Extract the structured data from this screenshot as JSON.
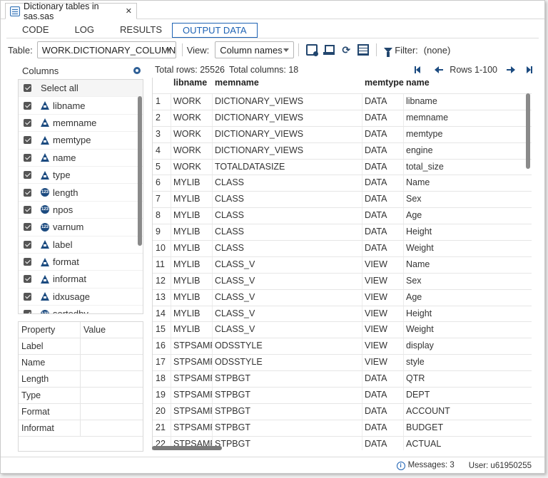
{
  "file_tab": {
    "title": "Dictionary tables in sas.sas",
    "close": "✕"
  },
  "tabs": [
    "CODE",
    "LOG",
    "RESULTS",
    "OUTPUT DATA"
  ],
  "toolbar": {
    "table_label": "Table:",
    "table_value": "WORK.DICTIONARY_COLUMN",
    "view_label": "View:",
    "view_value": "Column names",
    "filter_label": "Filter:",
    "filter_value": "(none)"
  },
  "columns_panel": {
    "title": "Columns",
    "items": [
      {
        "label": "Select all",
        "type": ""
      },
      {
        "label": "libname",
        "type": "char"
      },
      {
        "label": "memname",
        "type": "char"
      },
      {
        "label": "memtype",
        "type": "char"
      },
      {
        "label": "name",
        "type": "char"
      },
      {
        "label": "type",
        "type": "char"
      },
      {
        "label": "length",
        "type": "num"
      },
      {
        "label": "npos",
        "type": "num"
      },
      {
        "label": "varnum",
        "type": "num"
      },
      {
        "label": "label",
        "type": "char"
      },
      {
        "label": "format",
        "type": "char"
      },
      {
        "label": "informat",
        "type": "char"
      },
      {
        "label": "idxusage",
        "type": "char"
      },
      {
        "label": "sortedby",
        "type": "num"
      }
    ]
  },
  "properties": {
    "headers": [
      "Property",
      "Value"
    ],
    "rows": [
      "Label",
      "Name",
      "Length",
      "Type",
      "Format",
      "Informat"
    ]
  },
  "grid": {
    "total_rows": "Total rows: 25526",
    "total_columns": "Total columns: 18",
    "rows_range": "Rows 1-100",
    "headers": [
      "",
      "libname",
      "memname",
      "memtype",
      "name"
    ],
    "rows": [
      [
        "1",
        "WORK",
        "DICTIONARY_VIEWS",
        "DATA",
        "libname"
      ],
      [
        "2",
        "WORK",
        "DICTIONARY_VIEWS",
        "DATA",
        "memname"
      ],
      [
        "3",
        "WORK",
        "DICTIONARY_VIEWS",
        "DATA",
        "memtype"
      ],
      [
        "4",
        "WORK",
        "DICTIONARY_VIEWS",
        "DATA",
        "engine"
      ],
      [
        "5",
        "WORK",
        "TOTALDATASIZE",
        "DATA",
        "total_size"
      ],
      [
        "6",
        "MYLIB",
        "CLASS",
        "DATA",
        "Name"
      ],
      [
        "7",
        "MYLIB",
        "CLASS",
        "DATA",
        "Sex"
      ],
      [
        "8",
        "MYLIB",
        "CLASS",
        "DATA",
        "Age"
      ],
      [
        "9",
        "MYLIB",
        "CLASS",
        "DATA",
        "Height"
      ],
      [
        "10",
        "MYLIB",
        "CLASS",
        "DATA",
        "Weight"
      ],
      [
        "11",
        "MYLIB",
        "CLASS_V",
        "VIEW",
        "Name"
      ],
      [
        "12",
        "MYLIB",
        "CLASS_V",
        "VIEW",
        "Sex"
      ],
      [
        "13",
        "MYLIB",
        "CLASS_V",
        "VIEW",
        "Age"
      ],
      [
        "14",
        "MYLIB",
        "CLASS_V",
        "VIEW",
        "Height"
      ],
      [
        "15",
        "MYLIB",
        "CLASS_V",
        "VIEW",
        "Weight"
      ],
      [
        "16",
        "STPSAMP",
        "ODSSTYLE",
        "VIEW",
        "display"
      ],
      [
        "17",
        "STPSAMP",
        "ODSSTYLE",
        "VIEW",
        "style"
      ],
      [
        "18",
        "STPSAMP",
        "STPBGT",
        "DATA",
        "QTR"
      ],
      [
        "19",
        "STPSAMP",
        "STPBGT",
        "DATA",
        "DEPT"
      ],
      [
        "20",
        "STPSAMP",
        "STPBGT",
        "DATA",
        "ACCOUNT"
      ],
      [
        "21",
        "STPSAMP",
        "STPBGT",
        "DATA",
        "BUDGET"
      ],
      [
        "22",
        "STPSAMP",
        "STPBGT",
        "DATA",
        "ACTUAL"
      ]
    ]
  },
  "status": {
    "messages": "Messages: 3",
    "user": "User: u61950255"
  },
  "colors": {
    "accent": "#1d62b4",
    "icon": "#1c4b80"
  }
}
